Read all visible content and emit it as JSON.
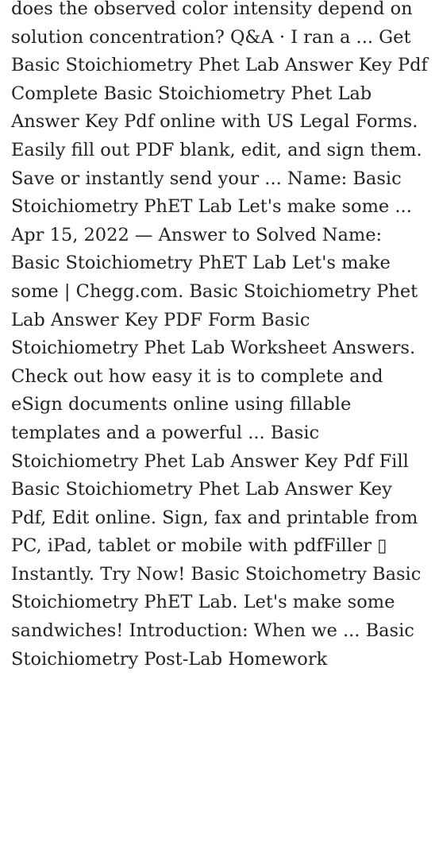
{
  "article": {
    "text": "does the observed color intensity depend on solution concentration? Q&A · I ran a ... Get Basic Stoichiometry Phet Lab Answer Key Pdf Complete Basic Stoichiometry Phet Lab Answer Key Pdf online with US Legal Forms. Easily fill out PDF blank, edit, and sign them. Save or instantly send your ... Name: Basic Stoichiometry PhET Lab Let's make some ... Apr 15, 2022 — Answer to Solved Name: Basic Stoichiometry PhET Lab Let's make some | Chegg.com. Basic Stoichiometry Phet Lab Answer Key PDF Form Basic Stoichiometry Phet Lab Worksheet Answers. Check out how easy it is to complete and eSign documents online using fillable templates and a powerful ... Basic Stoichiometry Phet Lab Answer Key Pdf Fill Basic Stoichiometry Phet Lab Answer Key Pdf, Edit online. Sign, fax and printable from PC, iPad, tablet or mobile with pdfFiller ▯ Instantly. Try Now! Basic Stoichometry Basic Stoichiometry PhET Lab. Let's make some sandwiches! Introduction: When we ... Basic Stoichiometry Post-Lab Homework"
  },
  "colors": {
    "text": "#222222",
    "background": "#ffffff"
  }
}
